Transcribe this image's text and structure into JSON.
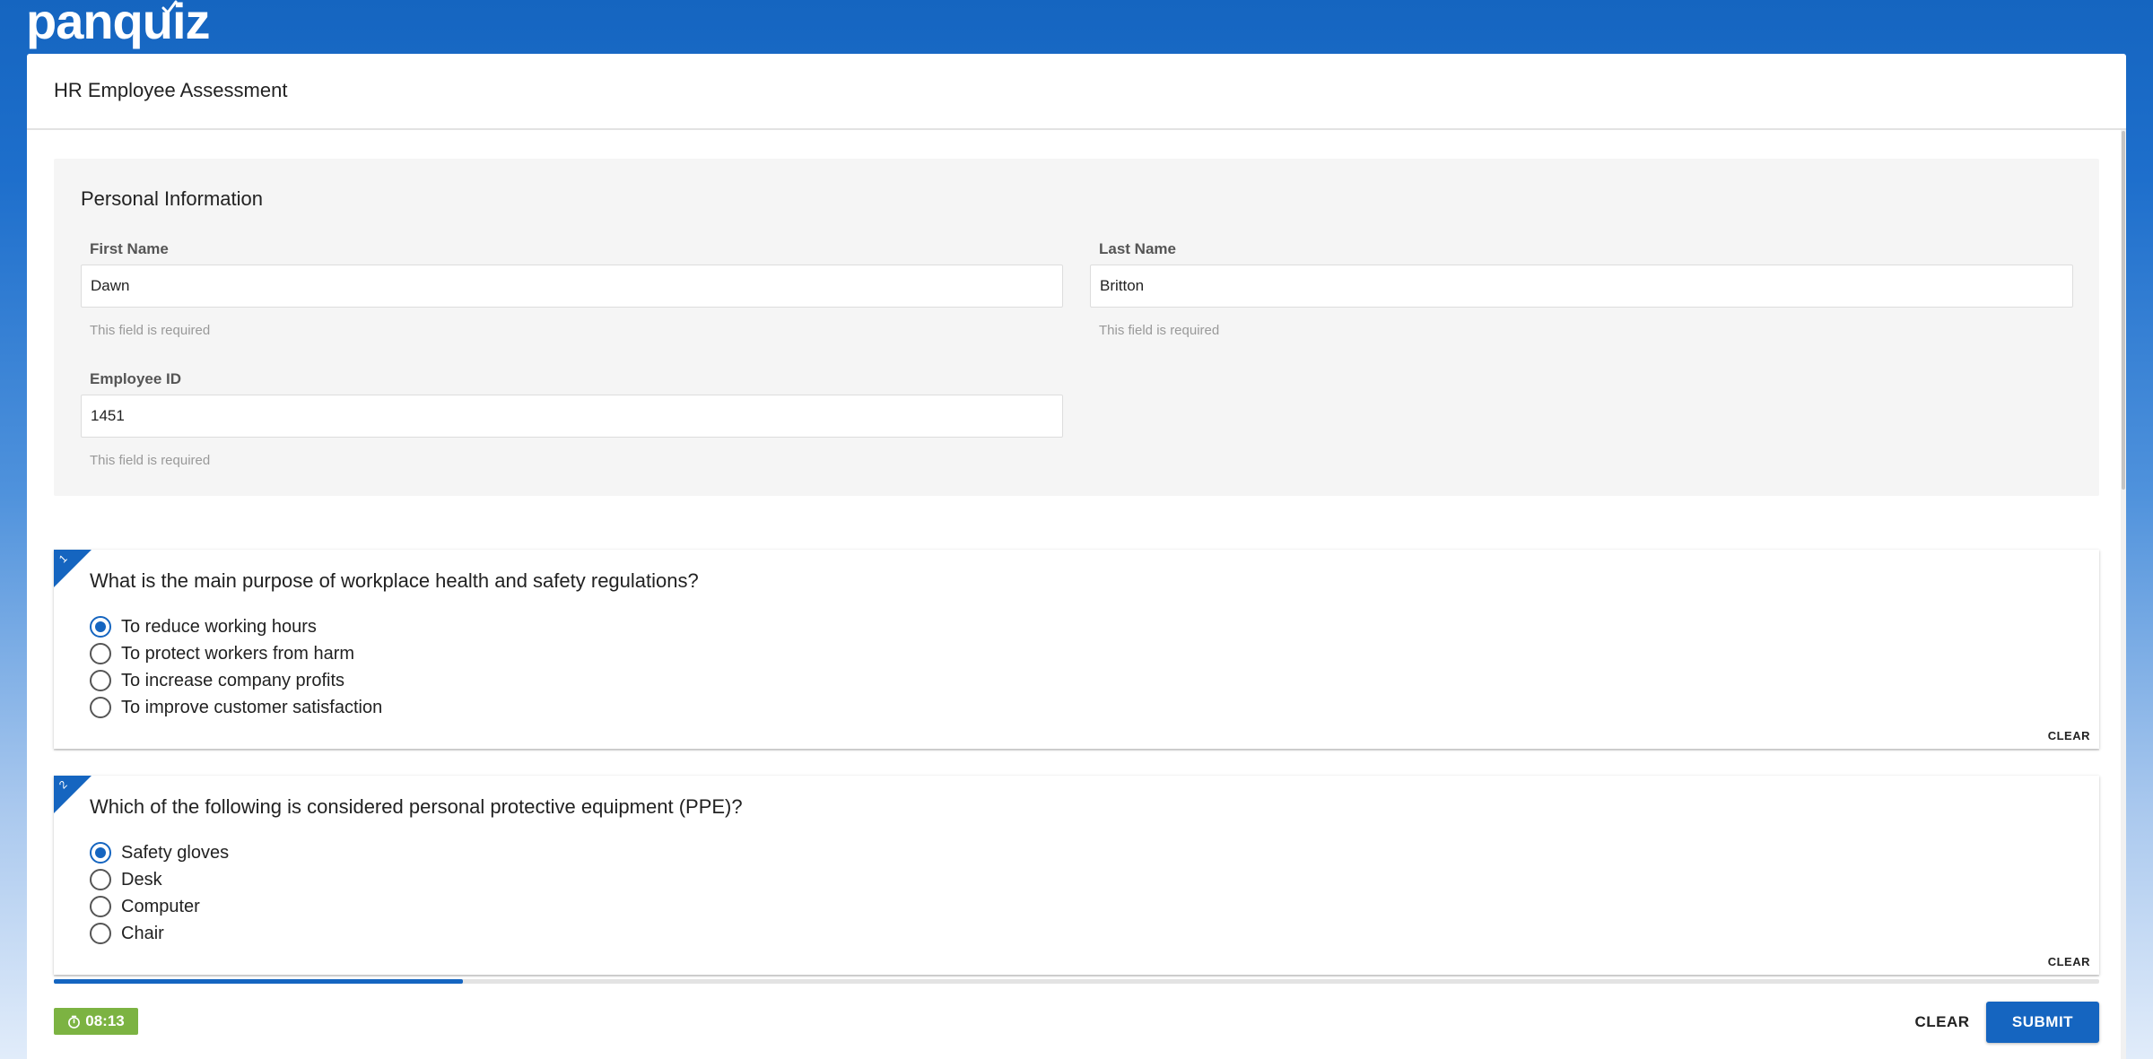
{
  "app": {
    "logo_text": "panquiz",
    "brand_color": "#1565c0",
    "accent_green": "#7cb342"
  },
  "quiz": {
    "title": "HR Employee Assessment"
  },
  "personal": {
    "section_title": "Personal Information",
    "first_name": {
      "label": "First Name",
      "value": "Dawn",
      "hint": "This field is required"
    },
    "last_name": {
      "label": "Last Name",
      "value": "Britton",
      "hint": "This field is required"
    },
    "employee_id": {
      "label": "Employee ID",
      "value": "1451",
      "hint": "This field is required"
    }
  },
  "questions": [
    {
      "number": "1",
      "text": "What is the main purpose of workplace health and safety regulations?",
      "options": [
        "To reduce working hours",
        "To protect workers from harm",
        "To increase company profits",
        "To improve customer satisfaction"
      ],
      "selected_index": 0,
      "clear_label": "CLEAR"
    },
    {
      "number": "2",
      "text": "Which of the following is considered personal protective equipment (PPE)?",
      "options": [
        "Safety gloves",
        "Desk",
        "Computer",
        "Chair"
      ],
      "selected_index": 0,
      "clear_label": "CLEAR"
    }
  ],
  "progress": {
    "fraction": 0.2
  },
  "footer": {
    "timer": "08:13",
    "timer_icon": "stopwatch-icon",
    "clear_label": "CLEAR",
    "submit_label": "SUBMIT"
  }
}
